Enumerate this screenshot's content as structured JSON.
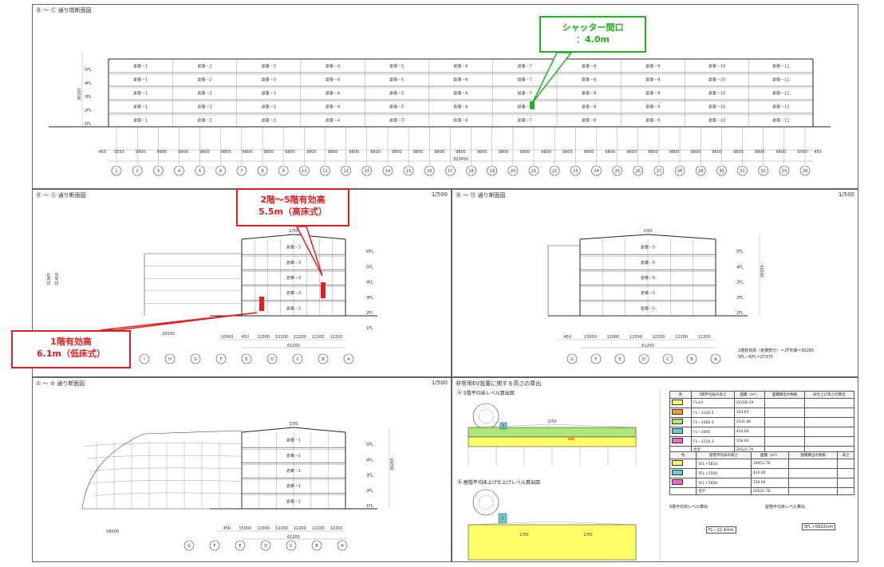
{
  "sheet": {
    "page_number": "3"
  },
  "panel_top": {
    "title": "Ⓑ ～ Ⓒ 通り間断面図",
    "rooms": [
      "倉庫－1",
      "倉庫－2",
      "倉庫－3",
      "倉庫－4",
      "倉庫－5",
      "倉庫－6",
      "倉庫－7",
      "倉庫－8",
      "倉庫－9",
      "倉庫－10",
      "倉庫－11"
    ],
    "floors": [
      "5FL",
      "4FL",
      "3FL",
      "2FL",
      "1FL"
    ],
    "span_dims": [
      "450",
      "9350",
      "9800",
      "9800",
      "9800",
      "9800",
      "9800",
      "9800",
      "9800",
      "9800",
      "9800",
      "9800",
      "9800",
      "9800",
      "9800",
      "9800",
      "9800",
      "9800",
      "9800",
      "9800",
      "9800",
      "9800",
      "9800",
      "9800",
      "9800",
      "9800",
      "9800",
      "9800",
      "9800",
      "9800",
      "9800",
      "9800",
      "9800",
      "9350",
      "450"
    ],
    "total_dim": "323400",
    "height_dim": "30265",
    "grid_labels": [
      "1",
      "2",
      "3",
      "4",
      "5",
      "6",
      "7",
      "8",
      "9",
      "10",
      "11",
      "12",
      "13",
      "14",
      "15",
      "16",
      "17",
      "18",
      "19",
      "20",
      "21",
      "22",
      "23",
      "24",
      "25",
      "26",
      "27",
      "28",
      "29",
      "30",
      "31",
      "32",
      "33",
      "34"
    ]
  },
  "panel_mid_left": {
    "title": "Ⓡ ～ Ⓢ 通り断面図",
    "scale": "1/500",
    "roof_slope": "1/50",
    "rooms": [
      "倉庫－3",
      "倉庫－3",
      "倉庫－3",
      "倉庫－3",
      "倉庫－3"
    ],
    "floors": [
      "RFL",
      "5FL",
      "4FL",
      "3FL",
      "2FL",
      "1FL"
    ],
    "span_dims": [
      "10000",
      "450",
      "12000",
      "12200",
      "12200",
      "12200",
      "12200"
    ],
    "total_dim": "61250",
    "left_dim": "20000",
    "height_dims": [
      "31465",
      "31400"
    ],
    "grid_labels": [
      "I",
      "H",
      "G",
      "F",
      "E",
      "D",
      "C",
      "B",
      "A"
    ]
  },
  "panel_mid_right": {
    "title": "⑭ ～ ⑮ 通り断面図",
    "scale": "1/500",
    "roof_slope": "1/50",
    "rooms": [
      "倉庫－5",
      "倉庫－5",
      "倉庫－5",
      "倉庫－5",
      "倉庫－5"
    ],
    "floors": [
      "5FL",
      "4FL",
      "3FL",
      "2FL",
      "1FL"
    ],
    "span_dims": [
      "450",
      "15000",
      "12000",
      "12200",
      "12200",
      "12200",
      "12200"
    ],
    "total_dim": "61250",
    "height_dim": "30265",
    "grid_labels": [
      "G",
      "F",
      "E",
      "D",
      "C",
      "B",
      "A"
    ],
    "notes": [
      "1階有効高（倉庫部分）＝2F天端＝30265",
      "5FL－RFL＝27375"
    ]
  },
  "panel_bot_left": {
    "title": "① ～ ② 通り断面図",
    "scale": "1/500",
    "roof_slope": "1/50",
    "rooms": [
      "倉庫－1",
      "倉庫－1",
      "倉庫－1",
      "倉庫－1",
      "倉庫－1"
    ],
    "floors": [
      "5FL",
      "4FL",
      "3FL",
      "2FL",
      "1FL"
    ],
    "span_dims": [
      "450",
      "15000",
      "12000",
      "12200",
      "12200",
      "12200",
      "12200"
    ],
    "total_dim": "61250",
    "left_dim": "58000",
    "height_dim": "30265",
    "grid_labels": [
      "G",
      "F",
      "E",
      "D",
      "C",
      "B",
      "A"
    ]
  },
  "panel_bot_right": {
    "title": "非常用EV設置に関する高さの算出",
    "section_a": "Ⓐ 5階平均床レベル算出図",
    "section_b": "Ⓑ 屋階平均床上げ仕上げレベル算出図",
    "slope_a": "1/50",
    "slope_b": "1/50",
    "marker_a": "1",
    "marker_b": "1",
    "table1": {
      "headers": [
        "色",
        "5階平均床の高さ",
        "面積（m²）",
        "面積算出の根拠",
        "床仕上げ高さの算出"
      ],
      "rows": [
        [
          "",
          "FL±0",
          "1621B.29",
          "",
          ""
        ],
        [
          "",
          "FL－1130.5",
          "163.63",
          "",
          ""
        ],
        [
          "",
          "FL－1069.3",
          "3531.86",
          "",
          ""
        ],
        [
          "",
          "FL－1000",
          "410.00",
          "",
          ""
        ],
        [
          "",
          "FL－1210.3",
          "158.00",
          "",
          ""
        ]
      ],
      "total": [
        "",
        "合計",
        "20522.78",
        "",
        ""
      ]
    },
    "table2": {
      "headers": [
        "色",
        "屋階平均床の高さ",
        "面積（m²）",
        "面積算出の根拠",
        "高さ"
      ],
      "rows": [
        [
          "",
          "5FL＋5810",
          "19953.78",
          "",
          ""
        ],
        [
          "",
          "5FL＋5500",
          "410.00",
          "",
          ""
        ],
        [
          "",
          "5FL＋5650",
          "159.00",
          "",
          ""
        ]
      ],
      "total": [
        "",
        "合計",
        "20522.78",
        "",
        ""
      ]
    },
    "calc_title_1": "5階平均床レベル算出",
    "calc_title_2": "屋階平均床レベル算出",
    "calc_result_1": "FL－22.4mm",
    "calc_result_2": "5FL＋5822mm"
  },
  "callouts": {
    "shutter": [
      "シャッター間口",
      "：4.0m"
    ],
    "effective_height_2_5": [
      "2階～5階有効高",
      "5.5m（高床式）"
    ],
    "effective_height_1": [
      "1階有効高",
      "6.1m（低床式）"
    ]
  },
  "colors": {
    "red": "#e02020",
    "green": "#22b022",
    "yellow": "#ffff66",
    "light_green": "#aee67a",
    "blue": "#66cccc",
    "magenta": "#ff66cc",
    "orange": "#ff9933"
  }
}
